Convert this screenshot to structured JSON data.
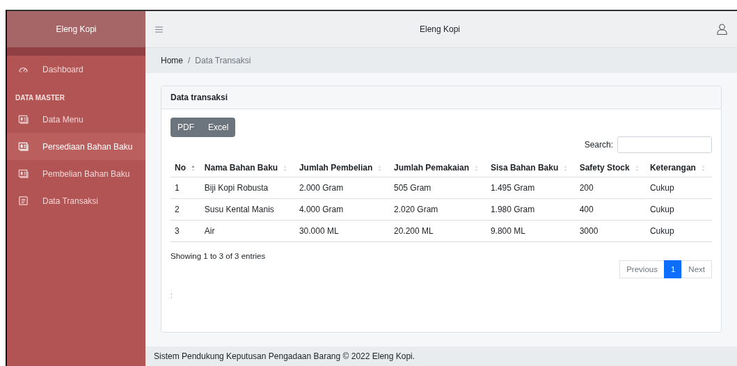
{
  "sidebar": {
    "brand": "Eleng Kopi",
    "items": [
      {
        "kind": "gauge",
        "label": "Dashboard",
        "selected": false
      }
    ],
    "section": "DATA MASTER",
    "section_items": [
      {
        "kind": "card",
        "label": "Data Menu",
        "selected": false
      },
      {
        "kind": "card",
        "label": "Persediaan Bahan Baku",
        "selected": true
      },
      {
        "kind": "card",
        "label": "Pembelian Bahan Baku",
        "selected": false
      },
      {
        "kind": "doc",
        "label": "Data Transaksi",
        "selected": false
      }
    ]
  },
  "header": {
    "title": "Eleng Kopi"
  },
  "breadcrumb": {
    "items": [
      "Home",
      "Data Transaksi"
    ],
    "separator": "/"
  },
  "card": {
    "title": "Data transaksi",
    "export_buttons": [
      "PDF",
      "Excel"
    ],
    "search_label": "Search:",
    "table": {
      "columns": [
        {
          "label": "No",
          "sorted": true
        },
        {
          "label": "Nama Bahan Baku",
          "sorted": false
        },
        {
          "label": "Jumlah Pembelian",
          "sorted": false
        },
        {
          "label": "Jumlah Pemakaian",
          "sorted": false
        },
        {
          "label": "Sisa Bahan Baku",
          "sorted": false
        },
        {
          "label": "Safety Stock",
          "sorted": false
        },
        {
          "label": "Keterangan",
          "sorted": false
        }
      ],
      "rows": [
        [
          "1",
          "Biji Kopi Robusta",
          "2.000 Gram",
          "505 Gram",
          "1.495 Gram",
          "200",
          "Cukup"
        ],
        [
          "2",
          "Susu Kental Manis",
          "4.000 Gram",
          "2.020 Gram",
          "1.980 Gram",
          "400",
          "Cukup"
        ],
        [
          "3",
          "Air",
          "30.000 ML",
          "20.200 ML",
          "9.800 ML",
          "3000",
          "Cukup"
        ]
      ]
    },
    "info": "Showing 1 to 3 of 3 entries",
    "pagination": [
      {
        "label": "Previous",
        "selected": false
      },
      {
        "label": "1",
        "selected": true
      },
      {
        "label": "Next",
        "selected": false
      }
    ],
    "note": ":"
  },
  "footer": "Sistem Pendukung Keputusan Pengadaan Barang © 2022 Eleng Kopi."
}
